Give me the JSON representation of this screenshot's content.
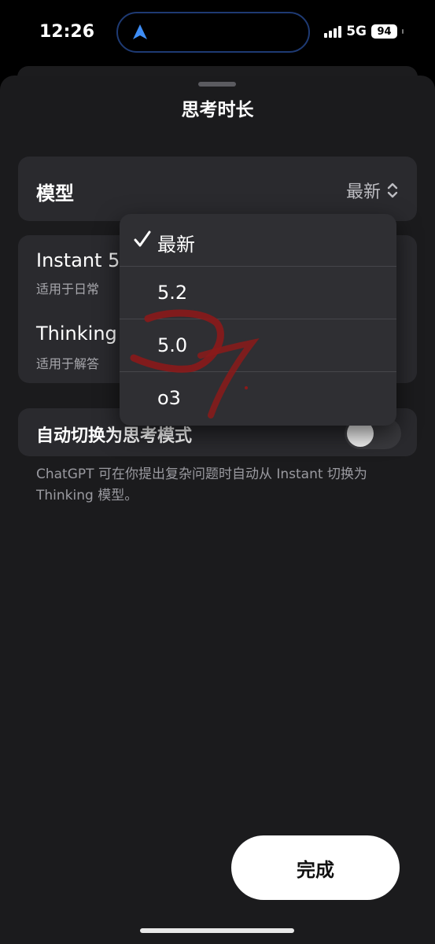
{
  "status_bar": {
    "time": "12:26",
    "network": "5G",
    "battery": "94"
  },
  "sheet": {
    "title": "思考时长"
  },
  "model_row": {
    "label": "模型",
    "value": "最新"
  },
  "options": [
    {
      "title": "Instant 5",
      "subtitle": "适用于日常"
    },
    {
      "title": "Thinking",
      "subtitle": "适用于解答"
    }
  ],
  "auto_switch": {
    "label": "自动切换为思考模式",
    "enabled": false,
    "description": "ChatGPT 可在你提出复杂问题时自动从 Instant 切换为 Thinking 模型。"
  },
  "dropdown": {
    "items": [
      {
        "label": "最新",
        "selected": true
      },
      {
        "label": "5.2",
        "selected": false
      },
      {
        "label": "5.0",
        "selected": false
      },
      {
        "label": "o3",
        "selected": false
      }
    ]
  },
  "done_button": {
    "label": "完成"
  },
  "colors": {
    "sheet_bg": "#1b1b1d",
    "card_bg": "#2a2a2e",
    "menu_bg": "#2f2f33",
    "annotation_red": "#8b1a1a"
  }
}
